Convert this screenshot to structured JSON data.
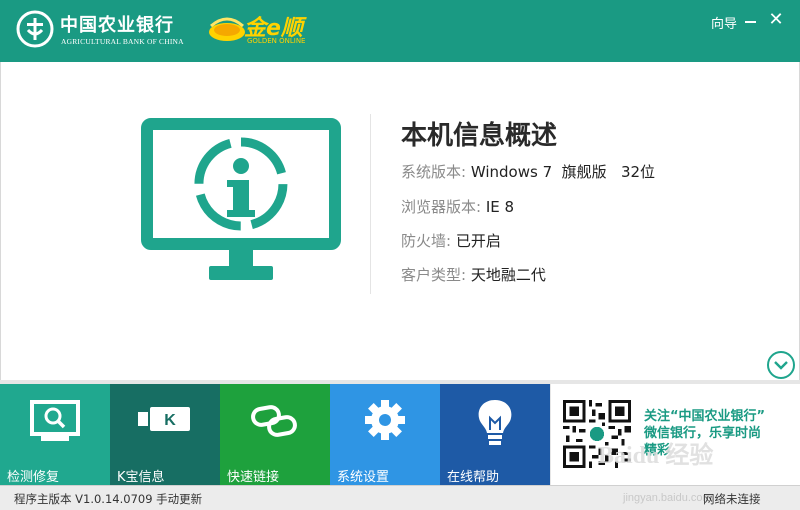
{
  "header": {
    "bank_name_cn": "中国农业银行",
    "bank_name_en": "AGRICULTURAL BANK OF CHINA",
    "partner_name": "金e顺",
    "partner_sub": "GOLDEN ONLINE",
    "guide_label": "向导",
    "minimize_icon": "minimize-icon",
    "close_label": "✕",
    "bg_color": "#1a9a83"
  },
  "info": {
    "title": "本机信息概述",
    "rows": [
      {
        "label": "系统版本:",
        "value": "Windows 7  旗舰版   32位"
      },
      {
        "label": "浏览器版本:",
        "value": "IE 8"
      },
      {
        "label": "防火墙:",
        "value": "已开启"
      },
      {
        "label": "客户类型:",
        "value": "天地融二代"
      }
    ],
    "icon": "monitor-info-icon",
    "expand_icon": "chevron-down-circle-icon"
  },
  "tiles": [
    {
      "label": "检测修复",
      "color": "#20a88f",
      "icon": "monitor-search-icon"
    },
    {
      "label": "K宝信息",
      "color": "#176e63",
      "icon": "usb-key-icon"
    },
    {
      "label": "快速链接",
      "color": "#1ea13d",
      "icon": "link-icon"
    },
    {
      "label": "系统设置",
      "color": "#2f95e4",
      "icon": "gear-icon"
    },
    {
      "label": "在线帮助",
      "color": "#1e5aa6",
      "icon": "lightbulb-icon"
    }
  ],
  "promo": {
    "line1": "关注“中国农业银行”",
    "line2": "微信银行，乐享时尚",
    "line3": "精彩",
    "watermark": "Baidu 经验"
  },
  "status": {
    "version_text": "程序主版本 V1.0.14.0709 手动更新",
    "network_text": "网络未连接",
    "url_text": "jingyan.baidu.com"
  }
}
